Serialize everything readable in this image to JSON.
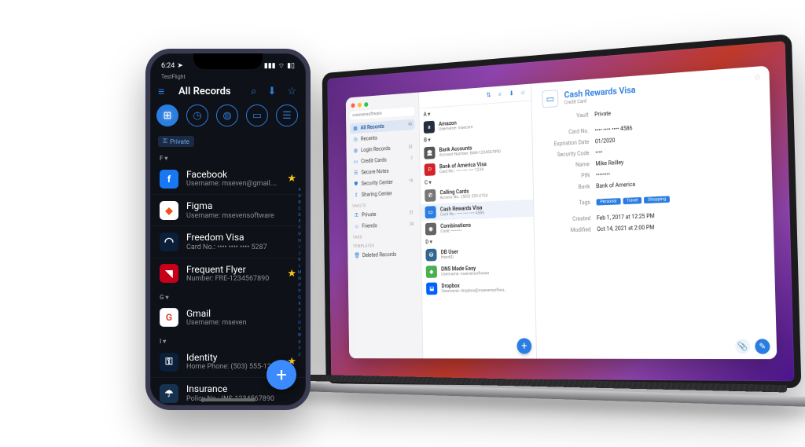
{
  "phone": {
    "statusbar": {
      "time": "6:24",
      "testflight": "TestFlight"
    },
    "title": "All Records",
    "chip": "Private",
    "sections": {
      "f": "F ▾",
      "g": "G ▾",
      "i": "I ▾"
    },
    "rows": {
      "facebook": {
        "title": "Facebook",
        "sub": "Username: mseven@gmail.com"
      },
      "figma": {
        "title": "Figma",
        "sub": "Username: msevensoftware"
      },
      "freedom": {
        "title": "Freedom Visa",
        "sub": "Card No.: •••• •••• •••• 5287"
      },
      "flyer": {
        "title": "Frequent Flyer",
        "sub": "Number: FRE-1234567890"
      },
      "gmail": {
        "title": "Gmail",
        "sub": "Username: mseven"
      },
      "identity": {
        "title": "Identity",
        "sub": "Home Phone: (503) 555-1234"
      },
      "insurance": {
        "title": "Insurance",
        "sub": "Policy No.: INS-1234567890"
      }
    }
  },
  "mac": {
    "search_placeholder": "msevensoftware",
    "sidebar": {
      "all": {
        "label": "All Records",
        "count": "45"
      },
      "recents": {
        "label": "Recents",
        "count": ""
      },
      "logins": {
        "label": "Login Records",
        "count": "23"
      },
      "cards": {
        "label": "Credit Cards",
        "count": "7"
      },
      "notes": {
        "label": "Secure Notes",
        "count": ""
      },
      "sec": {
        "label": "Security Center",
        "count": "15"
      },
      "share": {
        "label": "Sharing Center",
        "count": ""
      },
      "vaults_header": "VAULTS",
      "private": {
        "label": "Private",
        "count": "21"
      },
      "friends": {
        "label": "Friends",
        "count": "24"
      },
      "tags_header": "TAGS",
      "templates_header": "TEMPLATES",
      "deleted": {
        "label": "Deleted Records",
        "count": ""
      }
    },
    "list": {
      "a": "A ▾",
      "b": "B ▾",
      "c": "C ▾",
      "d": "D ▾",
      "amazon": {
        "title": "Amazon",
        "sub": "Username: msecure"
      },
      "bankacc": {
        "title": "Bank Accounts",
        "sub": "Account Number: BAN-1234567890"
      },
      "boa": {
        "title": "Bank of America Visa",
        "sub": "Card No.: •••• •••• •••• 1234"
      },
      "calling": {
        "title": "Calling Cards",
        "sub": "Access No.: (503) 253-2754"
      },
      "cash": {
        "title": "Cash Rewards Visa",
        "sub": "Card No.: •••• •••• •••• 4586"
      },
      "comb": {
        "title": "Combinations",
        "sub": "Code: ••••••••"
      },
      "dbuser": {
        "title": "DB User",
        "sub": "HandID"
      },
      "dns": {
        "title": "DNS Made Easy",
        "sub": "Username: msevensoftware"
      },
      "dropbox": {
        "title": "Dropbox",
        "sub": "Username: dropbox@msevensoftwa…"
      }
    },
    "detail": {
      "title": "Cash Rewards Visa",
      "type": "Credit Card",
      "vault_label": "Vault",
      "vault": "Private",
      "cardno_label": "Card No.",
      "cardno": "•••• •••• •••• 4586",
      "exp_label": "Expiration Date",
      "exp": "01/2020",
      "sec_label": "Security Code",
      "sec": "••••",
      "name_label": "Name",
      "name": "Mike Reilley",
      "pin_label": "PIN",
      "pin": "••••••••",
      "bank_label": "Bank",
      "bank": "Bank of America",
      "tags_label": "Tags",
      "tag1": "Personal",
      "tag2": "Travel",
      "tag3": "Shopping",
      "created_label": "Created",
      "created": "Feb 1, 2017 at 12:25 PM",
      "modified_label": "Modified",
      "modified": "Oct 14, 2021 at 2:00 PM"
    }
  },
  "alpha_index": [
    "#",
    "A",
    "B",
    "C",
    "D",
    "E",
    "F",
    "G",
    "H",
    "I",
    "J",
    "K",
    "L",
    "M",
    "N",
    "O",
    "P",
    "Q",
    "R",
    "S",
    "T",
    "U",
    "V",
    "W",
    "X",
    "Y",
    "Z"
  ]
}
